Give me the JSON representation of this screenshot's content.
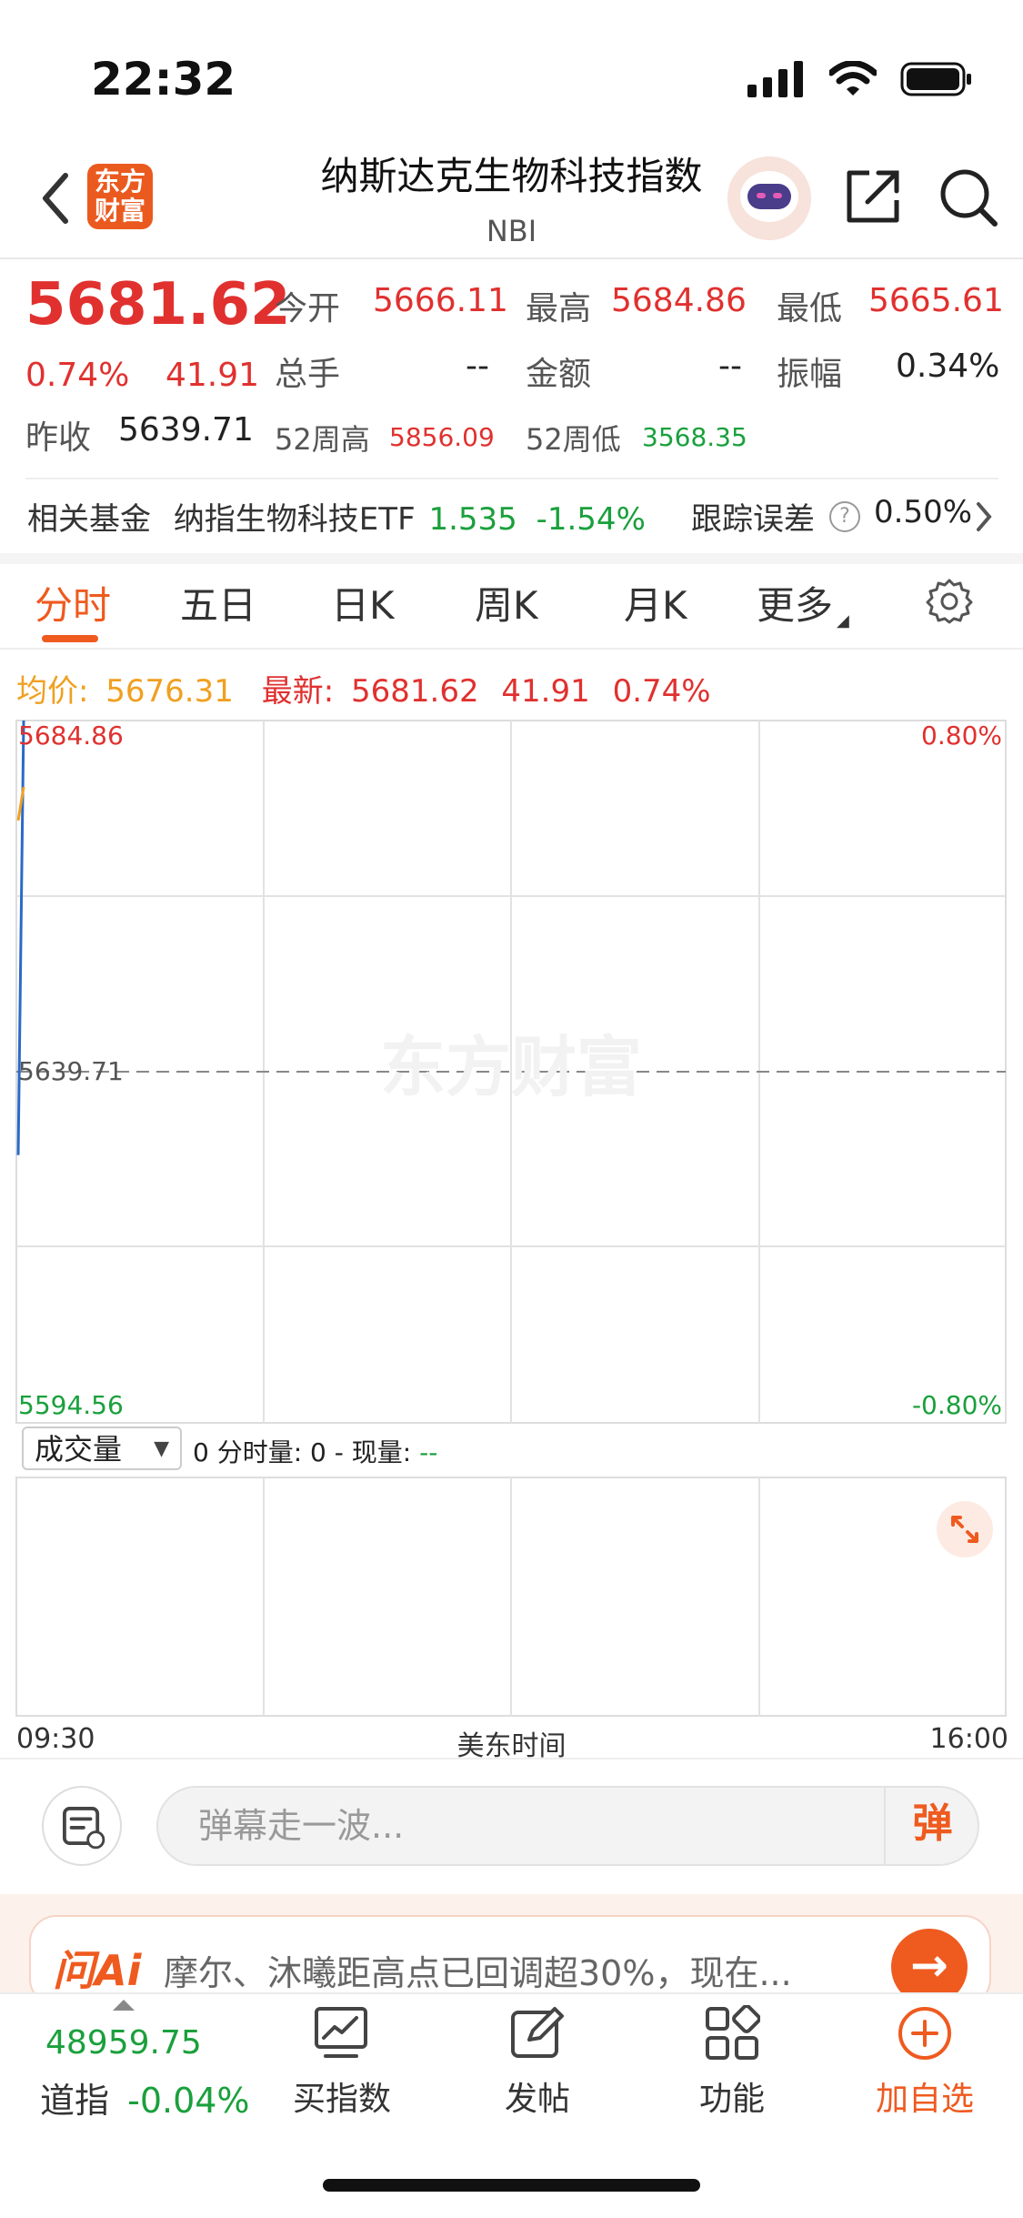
{
  "status_bar": {
    "time": "22:32"
  },
  "header": {
    "logo_text_line1": "东方",
    "logo_text_line2": "财富",
    "title": "纳斯达克生物科技指数",
    "subtitle": "NBI"
  },
  "quote": {
    "price": "5681.62",
    "change_pct": "0.74%",
    "change": "41.91",
    "open_label": "今开",
    "open_value": "5666.11",
    "high_label": "最高",
    "high_value": "5684.86",
    "low_label": "最低",
    "low_value": "5665.61",
    "volume_label": "总手",
    "volume_value": "--",
    "amount_label": "金额",
    "amount_value": "--",
    "amplitude_label": "振幅",
    "amplitude_value": "0.34%",
    "prev_close_label": "昨收",
    "prev_close_value": "5639.71",
    "week52_high_label": "52周高",
    "week52_high_value": "5856.09",
    "week52_low_label": "52周低",
    "week52_low_value": "3568.35"
  },
  "related_fund": {
    "label": "相关基金",
    "name": "纳指生物科技ETF",
    "price": "1.535",
    "change": "-1.54%",
    "tracking_label": "跟踪误差",
    "tracking_value": "0.50%"
  },
  "tabs": [
    {
      "label": "分时",
      "active": true
    },
    {
      "label": "五日"
    },
    {
      "label": "日K"
    },
    {
      "label": "周K"
    },
    {
      "label": "月K"
    },
    {
      "label": "更多"
    }
  ],
  "stats": {
    "avg_label": "均价:",
    "avg_value": "5676.31",
    "latest_label": "最新:",
    "latest_value": "5681.62",
    "latest_change": "41.91",
    "latest_pct": "0.74%"
  },
  "chart_data": {
    "type": "line",
    "x_start": "09:30",
    "x_end": "16:00",
    "x_label": "美东时间",
    "y_top": "5684.86",
    "y_mid": "5639.71",
    "y_bottom": "5594.56",
    "pct_top": "0.80%",
    "pct_bottom": "-0.80%",
    "watermark": "东方财富",
    "ylim": [
      5594.56,
      5684.86
    ],
    "baseline": 5639.71,
    "grid": true,
    "series": [
      {
        "color": "#2a6ac8",
        "values": [
          5629.0,
          5684.86
        ]
      },
      {
        "color": "#f0a020",
        "values": [
          5672.0,
          5676.31
        ]
      }
    ]
  },
  "volume": {
    "selector": "成交量",
    "info_prefix": "0 分时量: 0 - 现量: ",
    "info_value": "--"
  },
  "danmaku": {
    "placeholder": "弹幕走一波...",
    "send_label": "弹"
  },
  "ai_banner": {
    "logo": "问Ai",
    "text": "摩尔、沐曦距高点已回调超30%，现在..."
  },
  "bottom_bar": {
    "index_value": "48959.75",
    "index_label": "道指",
    "index_change": "-0.04%",
    "items": [
      {
        "label": "买指数"
      },
      {
        "label": "发帖"
      },
      {
        "label": "功能"
      },
      {
        "label": "加自选"
      }
    ]
  },
  "colors": {
    "up": "#e0312f",
    "down": "#1aa03c",
    "accent": "#ef5a1f",
    "avg": "#f0a020"
  }
}
